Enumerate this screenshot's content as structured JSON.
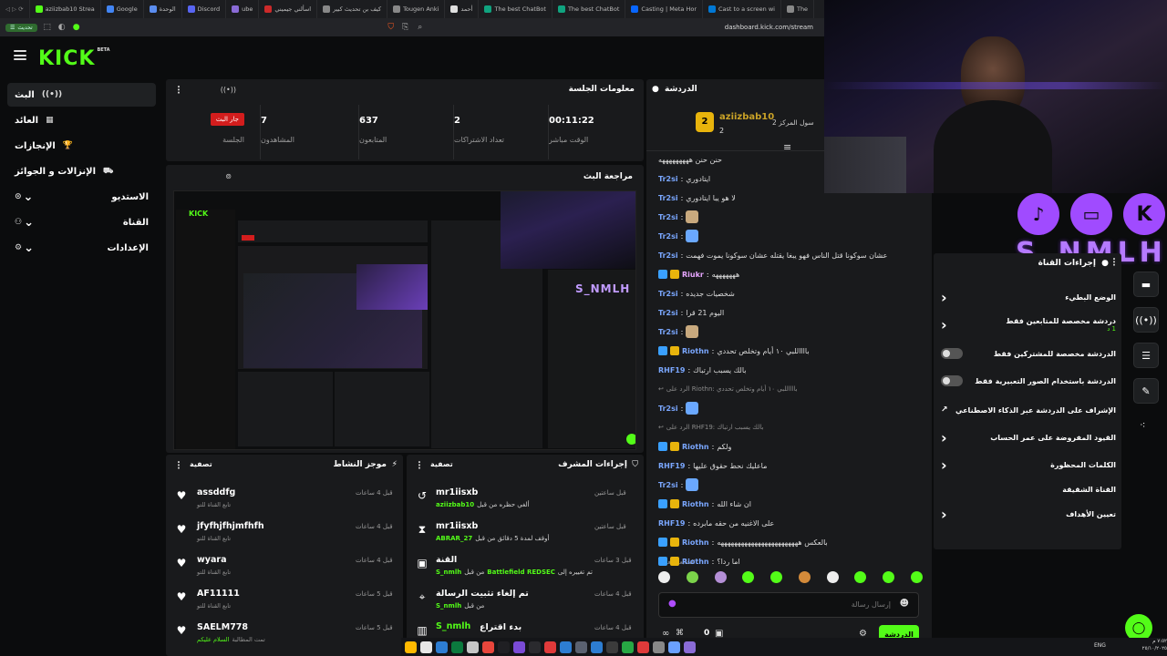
{
  "browser": {
    "tabs": [
      {
        "label": "aziizbab10 Strea",
        "color": "#53fc18"
      },
      {
        "label": "Google",
        "color": "#4285f4"
      },
      {
        "label": "الوحدة",
        "color": "#5b8def"
      },
      {
        "label": "Discord",
        "color": "#5865f2"
      },
      {
        "label": "ube",
        "color": "#8a6bd6"
      },
      {
        "label": "اسألني جيميني",
        "color": "#cc2a2a"
      },
      {
        "label": "كيف بن تحديث كبير",
        "color": "#888888"
      },
      {
        "label": "Tougen Anki",
        "color": "#888888"
      },
      {
        "label": "أحمد",
        "color": "#e0e0e0"
      },
      {
        "label": "The best ChatBot",
        "color": "#10a37f"
      },
      {
        "label": "The best ChatBot",
        "color": "#10a37f"
      },
      {
        "label": "Casting | Meta Hor",
        "color": "#0866ff"
      },
      {
        "label": "Cast to a screen wi",
        "color": "#0078d4"
      },
      {
        "label": "The",
        "color": "#888888"
      }
    ],
    "update_label": "تحديث",
    "url": "dashboard.kick.com/stream"
  },
  "brand": {
    "logo": "KICK",
    "beta": "BETA",
    "accent": "#53fc18"
  },
  "sidebar": {
    "items": [
      {
        "label": "البث",
        "icon": "((•))"
      },
      {
        "label": "العائد",
        "icon": "▦"
      },
      {
        "label": "الإنجازات",
        "icon": "🏆"
      },
      {
        "label": "الإنزالات و الجوائز",
        "icon": "⛟"
      },
      {
        "label": "الاستديو",
        "icon": "⊙"
      },
      {
        "label": "القناة",
        "icon": "⚇"
      },
      {
        "label": "الإعدادات",
        "icon": "⚙"
      }
    ]
  },
  "session": {
    "title": "معلومات الجلسة",
    "live_badge": "جار البث",
    "stats": [
      {
        "value": "",
        "label": "الجلسة"
      },
      {
        "value": "7",
        "label": "المشاهدون"
      },
      {
        "value": "637",
        "label": "المتابعون"
      },
      {
        "value": "2",
        "label": "تعداد الاشتراكات"
      },
      {
        "value": "00:11:22",
        "label": "الوقت مباشر"
      }
    ]
  },
  "preview": {
    "title": "مراجعة البث"
  },
  "activity": {
    "title": "موجز النشاط",
    "filter": "تصفية",
    "items": [
      {
        "name": "assddfg",
        "sub": "تابع القناة للتو",
        "time": "قبل 4 ساعات",
        "icon": "♥"
      },
      {
        "name": "jfyfhjfhjmfhfh",
        "sub": "تابع القناة للتو",
        "time": "قبل 4 ساعات",
        "icon": "♥"
      },
      {
        "name": "wyara",
        "sub": "تابع القناة للتو",
        "time": "قبل 4 ساعات",
        "icon": "♥"
      },
      {
        "name": "AF11111",
        "sub": "تابع القناة للتو",
        "time": "قبل 5 ساعات",
        "icon": "♥"
      },
      {
        "name": "SAELM778",
        "sub": "تمت المطالبة",
        "sub2": "السلام عليكم",
        "time": "قبل 5 ساعات",
        "icon": "♥"
      }
    ]
  },
  "moderation": {
    "title": "إجراءات المشرف",
    "filter": "تصفية",
    "items": [
      {
        "name": "mr1iisxb",
        "sub": "ألغي حظره من قبل",
        "actor": "aziizbab10",
        "time": "قبل ساعتين",
        "icon": "↺"
      },
      {
        "name": "mr1iisxb",
        "sub": "أوقف لمدة 5 دقائق من قبل",
        "actor": "ABRAR_27",
        "time": "قبل ساعتين",
        "icon": "⧗"
      },
      {
        "name": "القنة",
        "sub": "تم تغييره إلى",
        "actor": "Battlefield REDSEC",
        "actor2": "S_nmlh",
        "sub2": "من قبل",
        "time": "قبل 3 ساعات",
        "icon": "▣"
      },
      {
        "name": "تم إلغاء تثبيت الرسالة",
        "sub": "من قبل",
        "actor": "S_nmlh",
        "time": "قبل 4 ساعات",
        "icon": "⌖"
      },
      {
        "name": "بدء اقتراع",
        "actor": "S_nmlh",
        "time": "قبل 4 ساعات",
        "icon": "▥"
      }
    ]
  },
  "chat": {
    "title": "الدردشة",
    "pinned_user": "aziizbab10",
    "pinned_rank": "2",
    "pinned_note": "سول المركز 2",
    "messages": [
      {
        "user": "",
        "text": "حنن حنن هههههههههه",
        "color": "#7aa7ff"
      },
      {
        "user": "Tr2si",
        "text": "ايتادوري",
        "color": "#7aa7ff"
      },
      {
        "user": "Tr2si",
        "text": "لا هو يبا ايتادوري",
        "color": "#7aa7ff"
      },
      {
        "user": "Tr2si",
        "text": "",
        "color": "#7aa7ff",
        "emote": "#c8a97e"
      },
      {
        "user": "Tr2si",
        "text": "",
        "color": "#7aa7ff",
        "emote": "#6aa8ff"
      },
      {
        "user": "Tr2si",
        "text": "عشان سوكونا قتل الناس فهو يبغا يقتله عشان سوكونا يموت فهمت",
        "color": "#7aa7ff"
      },
      {
        "user": "Riukr",
        "text": "هههههههه",
        "color": "#e7a6ff",
        "badges": true
      },
      {
        "user": "Tr2si",
        "text": "شخصيات جديده",
        "color": "#7aa7ff"
      },
      {
        "user": "Tr2si",
        "text": "اليوم 21 قرا",
        "color": "#7aa7ff"
      },
      {
        "user": "Tr2si",
        "text": "",
        "color": "#7aa7ff",
        "emote": "#c8a97e"
      },
      {
        "user": "Riothn",
        "text": "بااااللبي ١٠ أيام وتخلص تحددي",
        "color": "#7aa7ff",
        "badges": true
      },
      {
        "user": "RHF19",
        "text": "بالك يسبب ارتباك",
        "color": "#7aa7ff"
      },
      {
        "user": "",
        "text": "الرد على Riothn: بااااللبي ١٠ أيام وتخلص تحددي",
        "color": "#8a8a8a",
        "reply": true
      },
      {
        "user": "Tr2si",
        "text": "",
        "color": "#7aa7ff",
        "emote": "#6aa8ff"
      },
      {
        "user": "",
        "text": "الرد على RHF19: بالك يسبب ارتباك",
        "color": "#8a8a8a",
        "reply": true
      },
      {
        "user": "Riothn",
        "text": "ولكم",
        "color": "#7aa7ff",
        "badges": true
      },
      {
        "user": "RHF19",
        "text": "ماعليك نحط حقوق عليها",
        "color": "#7aa7ff"
      },
      {
        "user": "Tr2si",
        "text": "",
        "color": "#7aa7ff",
        "emote": "#6aa8ff"
      },
      {
        "user": "Riothn",
        "text": "ان شاء الله",
        "color": "#7aa7ff",
        "badges": true
      },
      {
        "user": "RHF19",
        "text": "على الاغنيه من حقه مابرده",
        "color": "#7aa7ff"
      },
      {
        "user": "Riothn",
        "text": "بالعكس ههههههههههههههههههههههههه",
        "color": "#7aa7ff",
        "badges": true
      },
      {
        "user": "Riothn",
        "text": "اما ردا؟",
        "color": "#7aa7ff",
        "badges": true
      }
    ],
    "followers_only": "المتابعون فقط",
    "input_placeholder": "إرسال رسالة",
    "send_label": "الدردشة",
    "viewer_count": "0"
  },
  "channel_actions": {
    "title": "إجراءات القناة",
    "items": [
      {
        "label": "الوضع البطيء",
        "control": "chevron"
      },
      {
        "label": "دردشة مخصصة للمتابعين فقط",
        "sub": "1 د",
        "control": "chevron"
      },
      {
        "label": "الدردشة مخصصة للمشتركين فقط",
        "control": "toggle"
      },
      {
        "label": "الدردشة باستخدام الصور التعبيرية فقط",
        "control": "toggle"
      },
      {
        "label": "الإشراف على الدردشة عبر الذكاء الاصطناعي",
        "control": "external"
      },
      {
        "label": "القيود المفروضة على عمر الحساب",
        "control": "chevron"
      },
      {
        "label": "الكلمات المحظورة",
        "control": "chevron"
      },
      {
        "label": "القناة الشقيقة",
        "control": "none"
      },
      {
        "label": "تعيين الأهداف",
        "control": "chevron"
      }
    ]
  },
  "overlay": {
    "handle": "S_NMLH"
  },
  "taskbar": {
    "lang": "ENG",
    "time": "٧:٥٢ م",
    "date": "٢٥/١٠/٢٠٢٥"
  }
}
